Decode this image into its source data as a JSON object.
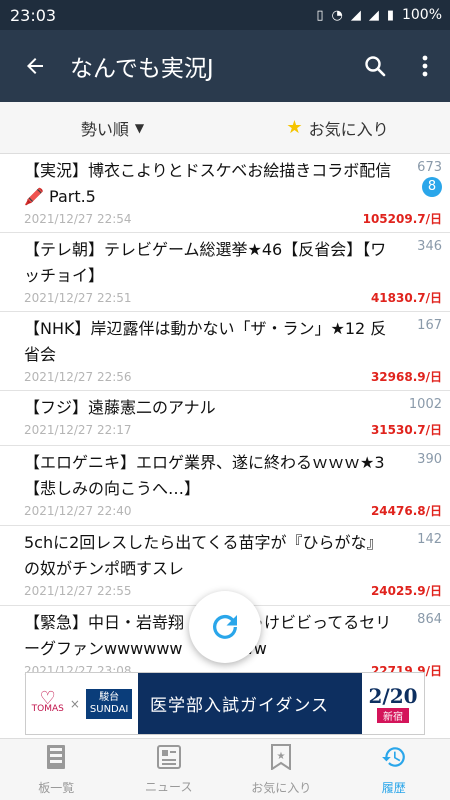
{
  "status": {
    "time": "23:03",
    "battery": "100%"
  },
  "appbar": {
    "title": "なんでも実況J"
  },
  "tabs": {
    "sort_label": "勢い順",
    "favorites_label": "お気に入り"
  },
  "threads": [
    {
      "title": "【実況】博衣こよりとドスケベお絵描きコラボ配信🖍️ Part.5",
      "date": "2021/12/27 22:54",
      "count": "673",
      "badge": "8",
      "speed": "105209.7/日"
    },
    {
      "title": "【テレ朝】テレビゲーム総選挙★46【反省会】【ワッチョイ】",
      "date": "2021/12/27 22:51",
      "count": "346",
      "badge": "",
      "speed": "41830.7/日"
    },
    {
      "title": "【NHK】岸辺露伴は動かない「ザ・ラン」★12 反省会",
      "date": "2021/12/27 22:56",
      "count": "167",
      "badge": "",
      "speed": "32968.9/日"
    },
    {
      "title": "【フジ】遠藤憲二のアナル",
      "date": "2021/12/27 22:17",
      "count": "1002",
      "badge": "",
      "speed": "31530.7/日"
    },
    {
      "title": "【エロゲニキ】エロゲ業界、遂に終わるｗｗｗ★3【悲しみの向こうへ…】",
      "date": "2021/12/27 22:40",
      "count": "390",
      "badge": "",
      "speed": "24476.8/日"
    },
    {
      "title": "5chに2回レスしたら出てくる苗字が『ひらがな』の奴がチンポ晒すスレ",
      "date": "2021/12/27 22:55",
      "count": "142",
      "badge": "",
      "speed": "24025.9/日"
    },
    {
      "title": "【緊急】中日・岩嵜翔　　　ちゃけビビってるセリーグファンwwwwww　　wwww",
      "date": "2021/12/27 23:08",
      "count": "864",
      "badge": "",
      "speed": "22719.9/日"
    }
  ],
  "ad": {
    "logo1": "TOMAS",
    "logo2_top": "駿台",
    "logo2_bottom": "SUNDAI",
    "x": "×",
    "headline": "医学部入試ガイダンス",
    "date": "2/20",
    "location": "新宿"
  },
  "nav": {
    "items": [
      {
        "label": "板一覧",
        "icon": "board-list-icon"
      },
      {
        "label": "ニュース",
        "icon": "news-icon"
      },
      {
        "label": "お気に入り",
        "icon": "bookmark-icon"
      },
      {
        "label": "履歴",
        "icon": "history-icon"
      }
    ]
  },
  "colors": {
    "appbar": "#2a3a4d",
    "accent": "#2aa6ea",
    "speed": "#e0231d"
  }
}
